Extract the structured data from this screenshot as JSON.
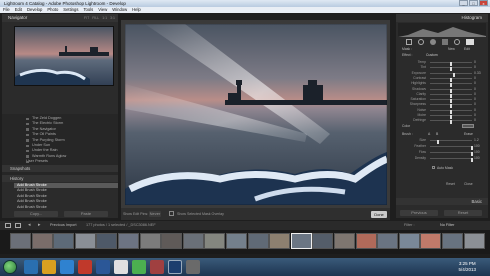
{
  "window": {
    "title": "Lightroom 4 Catalog - Adobe Photoshop Lightroom - Develop",
    "buttons": [
      "_",
      "□",
      "x"
    ]
  },
  "menu": [
    "File",
    "Edit",
    "Develop",
    "Photo",
    "Settings",
    "Tools",
    "View",
    "Window",
    "Help"
  ],
  "left_panel": {
    "navigator": {
      "title": "Navigator",
      "zoom": [
        "FIT",
        "FILL",
        "1:1",
        "3:1"
      ]
    },
    "presets": [
      "The Zeld Doggen",
      "The Electric Storm",
      "The Navigator",
      "The Oil Paints",
      "The Purpling Storm",
      "Under Sun",
      "Under the Rain",
      "Warmth Runs Aglow",
      "User Presets",
      "Contrast Preset"
    ],
    "snapshots": {
      "title": "Snapshots"
    },
    "history": {
      "title": "History",
      "items": [
        "Add Brush Stroke",
        "Add Brush Stroke",
        "Add Brush Stroke",
        "Add Brush Stroke",
        "Add Brush Stroke"
      ]
    },
    "buttons": {
      "copy": "Copy...",
      "paste": "Paste"
    }
  },
  "toolbar": {
    "show_edit_pins": "Show Edit Pins:",
    "pins_value": "Never",
    "overlay": "Show Selected Mask Overlay",
    "done": "Done"
  },
  "right_panel": {
    "histogram": {
      "title": "Histogram"
    },
    "mask": {
      "label": "Mask :",
      "new": "New",
      "edit": "Edit"
    },
    "effect": {
      "label": "Effect :",
      "value": "Custom"
    },
    "sliders": [
      {
        "label": "Temp",
        "value": "0",
        "level": 0.5
      },
      {
        "label": "Tint",
        "value": "0",
        "level": 0.5
      },
      {
        "label": "Exposure",
        "value": "0.33",
        "level": 0.56
      },
      {
        "label": "Contrast",
        "value": "0",
        "level": 0.5
      },
      {
        "label": "Highlights",
        "value": "0",
        "level": 0.5
      },
      {
        "label": "Shadows",
        "value": "0",
        "level": 0.5
      },
      {
        "label": "Clarity",
        "value": "0",
        "level": 0.5
      },
      {
        "label": "Saturation",
        "value": "0",
        "level": 0.5
      },
      {
        "label": "Sharpness",
        "value": "0",
        "level": 0.5
      },
      {
        "label": "Noise",
        "value": "0",
        "level": 0.5
      },
      {
        "label": "Moire",
        "value": "0",
        "level": 0.5
      },
      {
        "label": "Defringe",
        "value": "0",
        "level": 0.5
      }
    ],
    "color": {
      "label": "Color",
      "value": ""
    },
    "brush": {
      "label": "Brush :",
      "a": "A",
      "b": "B",
      "erase": "Erase"
    },
    "brush_sliders": [
      {
        "label": "Size",
        "value": "1.2",
        "level": 0.2
      },
      {
        "label": "Feather",
        "value": "100",
        "level": 1.0
      },
      {
        "label": "Flow",
        "value": "100",
        "level": 1.0
      },
      {
        "label": "Density",
        "value": "100",
        "level": 1.0
      }
    ],
    "auto_mask": "Auto Mask",
    "reset": "Reset",
    "close": "Close",
    "basic": "Basic",
    "buttons": {
      "previous": "Previous",
      "reset": "Reset"
    }
  },
  "filmstrip": {
    "source": "Previous Import",
    "count": "177 photos / 1 selected / _DSC3086.NEF",
    "filter_label": "Filter :",
    "filter_value": "No Filter"
  },
  "taskbar": {
    "time": "3:25 PM",
    "date": "5/4/2013"
  }
}
